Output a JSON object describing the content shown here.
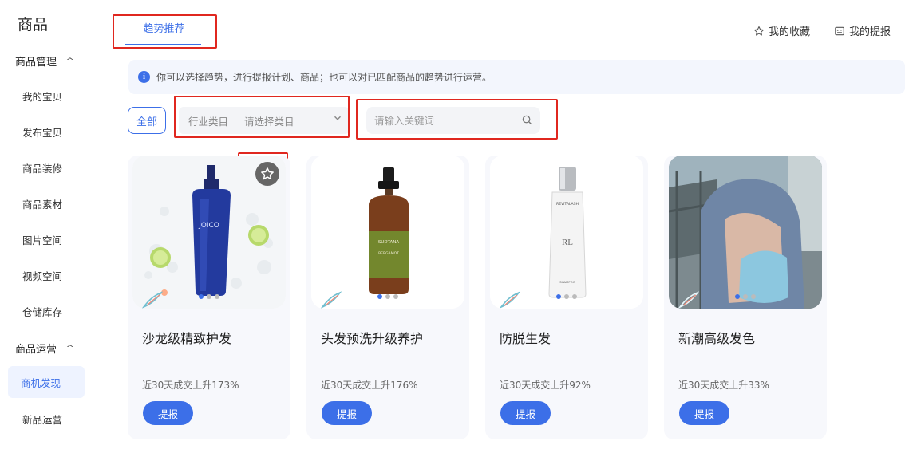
{
  "sidebar": {
    "title": "商品",
    "groups": [
      {
        "label": "商品管理"
      },
      {
        "label": "商品运营"
      }
    ],
    "items": [
      {
        "label": "我的宝贝"
      },
      {
        "label": "发布宝贝"
      },
      {
        "label": "商品装修"
      },
      {
        "label": "商品素材"
      },
      {
        "label": "图片空间"
      },
      {
        "label": "视频空间"
      },
      {
        "label": "仓储库存"
      },
      {
        "label": "商机发现"
      },
      {
        "label": "新品运营"
      }
    ]
  },
  "tabs": {
    "active_label": "趋势推荐",
    "favorites_label": "我的收藏",
    "reports_label": "我的提报"
  },
  "info": {
    "text": "你可以选择趋势，进行提报计划、商品；也可以对已匹配商品的趋势进行运营。"
  },
  "filters": {
    "all_label": "全部",
    "category_label": "行业类目",
    "category_value": "请选择类目",
    "search_placeholder": "请输入关键词"
  },
  "cards": [
    {
      "title": "沙龙级精致护发",
      "stat": "近30天成交上升173%",
      "button": "提报",
      "active_dot": 0,
      "dots": 3
    },
    {
      "title": "头发预洗升级养护",
      "stat": "近30天成交上升176%",
      "button": "提报",
      "active_dot": 0,
      "dots": 3
    },
    {
      "title": "防脱生发",
      "stat": "近30天成交上升92%",
      "button": "提报",
      "active_dot": 0,
      "dots": 3
    },
    {
      "title": "新潮高级发色",
      "stat": "近30天成交上升33%",
      "button": "提报",
      "active_dot": 0,
      "dots": 3
    }
  ],
  "colors": {
    "accent": "#3c6fe8",
    "highlight_box": "#e0271f"
  }
}
